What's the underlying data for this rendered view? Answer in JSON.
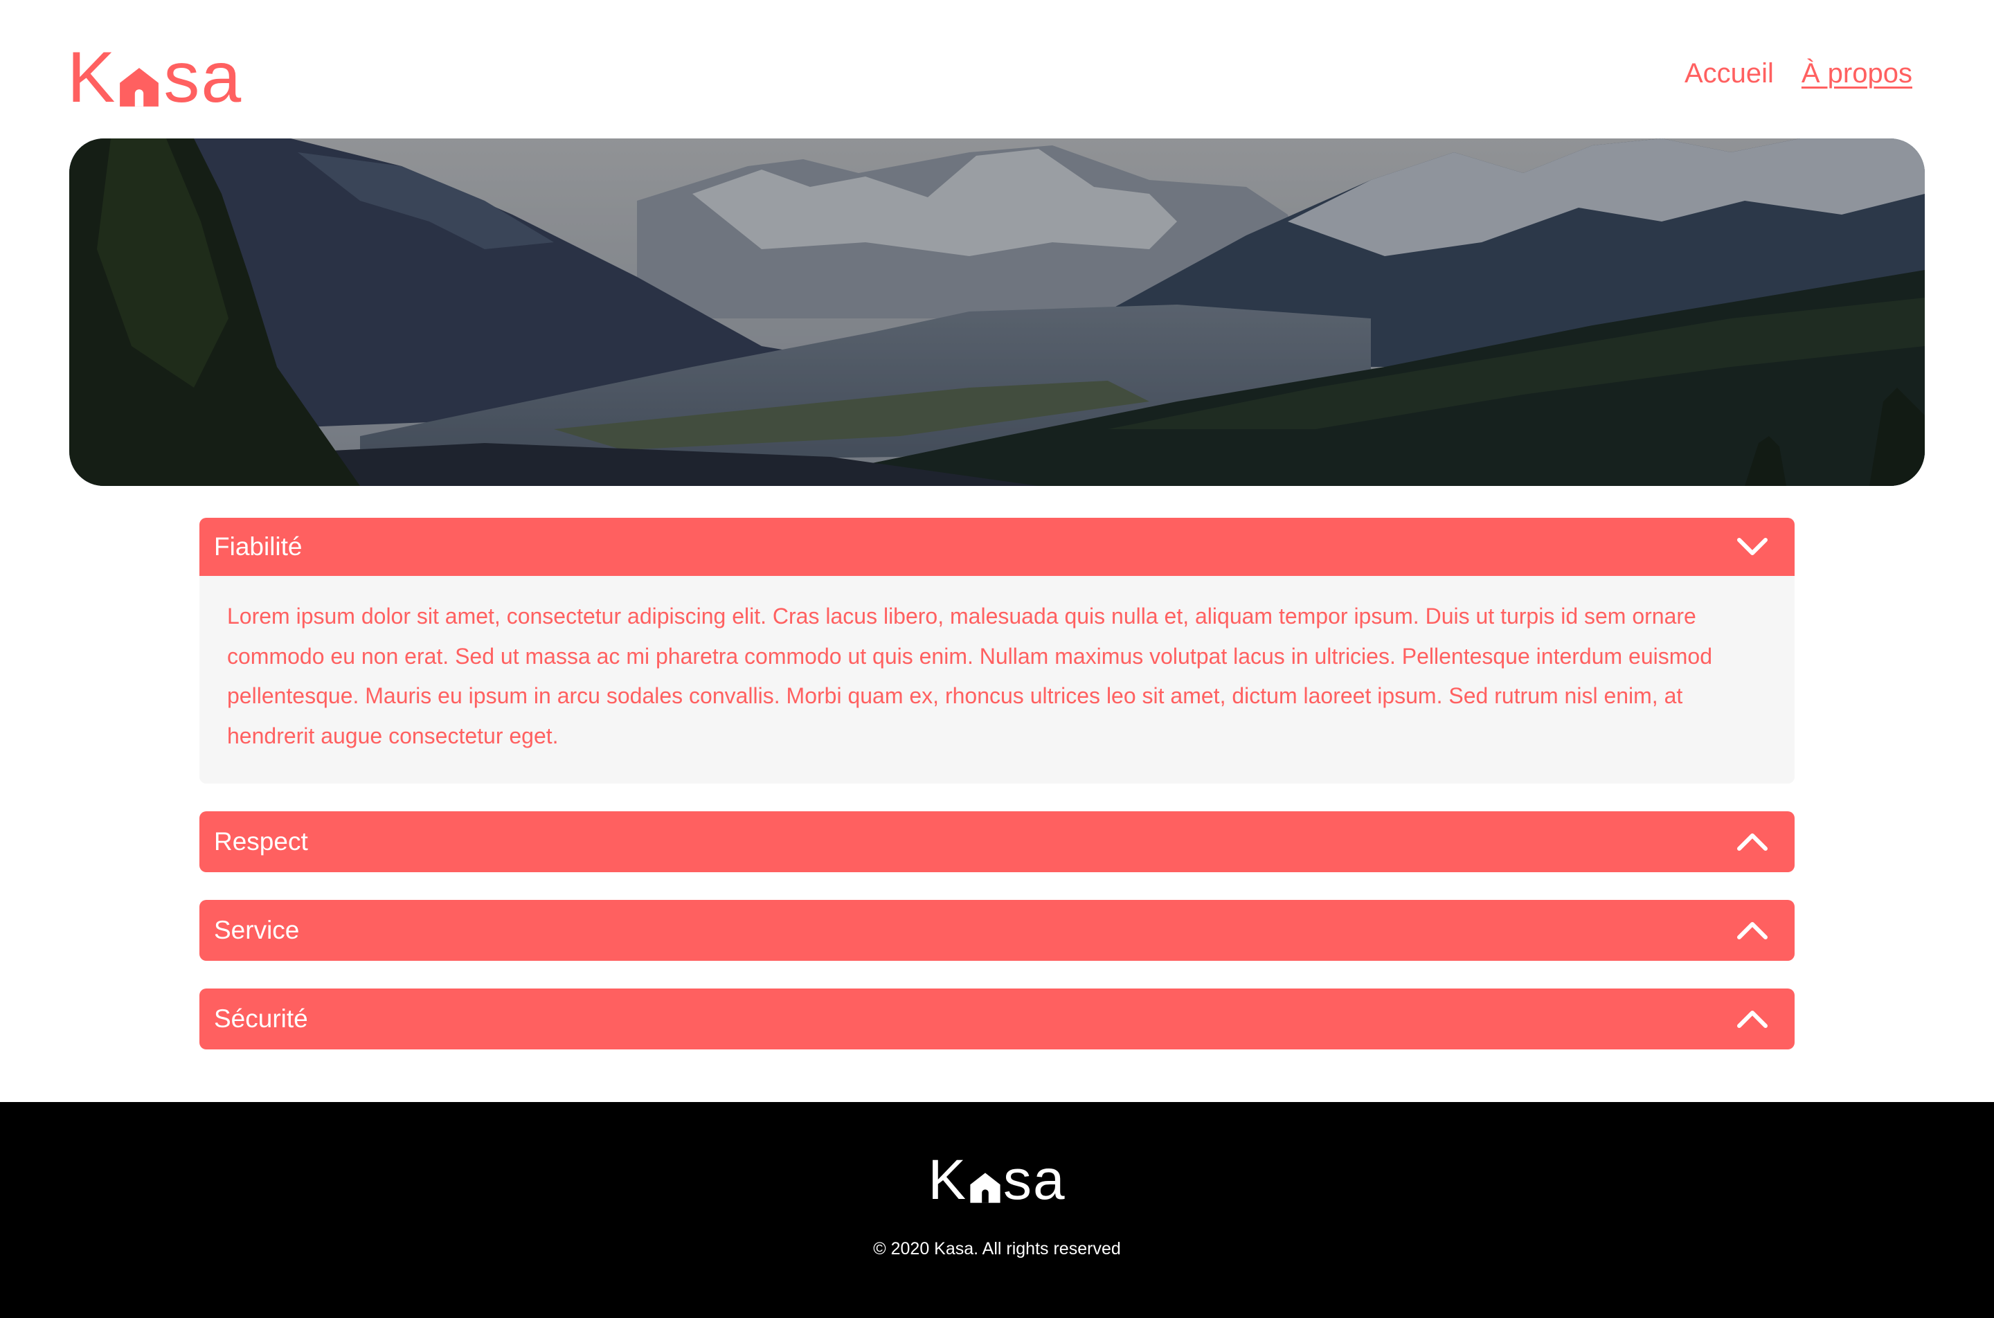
{
  "colors": {
    "brand": "#ff6060",
    "text_light": "#ffffff",
    "panel_bg": "#f6f6f6",
    "footer_bg": "#000000"
  },
  "brand": {
    "logo_text_start": "K",
    "logo_text_end": "sa",
    "logo_icon": "house-icon"
  },
  "nav": {
    "items": [
      {
        "label": "Accueil",
        "active": false
      },
      {
        "label": "À propos",
        "active": true
      }
    ]
  },
  "banner": {
    "image": "mountain-valley-photo"
  },
  "accordion": {
    "items": [
      {
        "title": "Fiabilité",
        "open": true,
        "icon": "chevron-down-icon",
        "body": "Lorem ipsum dolor sit amet, consectetur adipiscing elit. Cras lacus libero, malesuada quis nulla et, aliquam tempor ipsum. Duis ut turpis id sem ornare commodo eu non erat. Sed ut massa ac mi pharetra commodo ut quis enim. Nullam maximus volutpat lacus in ultricies. Pellentesque interdum euismod pellentesque. Mauris eu ipsum in arcu sodales convallis. Morbi quam ex, rhoncus ultrices leo sit amet, dictum laoreet ipsum. Sed rutrum nisl enim, at hendrerit augue consectetur eget."
      },
      {
        "title": "Respect",
        "open": false,
        "icon": "chevron-up-icon"
      },
      {
        "title": "Service",
        "open": false,
        "icon": "chevron-up-icon"
      },
      {
        "title": "Sécurité",
        "open": false,
        "icon": "chevron-up-icon"
      }
    ]
  },
  "footer": {
    "copyright": "© 2020 Kasa. All rights reserved"
  }
}
